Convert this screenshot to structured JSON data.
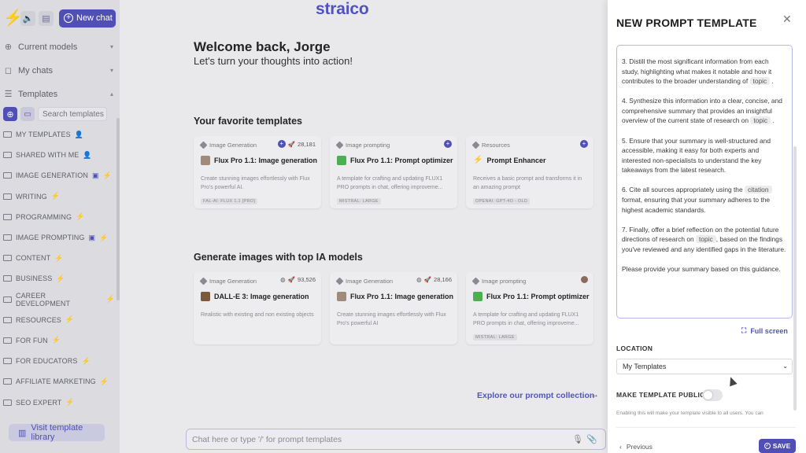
{
  "sidebar": {
    "new_chat_label": "New chat",
    "sections": [
      {
        "label": "Current models"
      },
      {
        "label": "My chats"
      },
      {
        "label": "Templates"
      }
    ],
    "search_placeholder": "Search templates",
    "folders": [
      {
        "label": "MY TEMPLATES",
        "badge": "user"
      },
      {
        "label": "SHARED WITH ME",
        "badge": "user"
      },
      {
        "label": "IMAGE GENERATION",
        "badge": "image-bolt"
      },
      {
        "label": "WRITING",
        "badge": "bolt"
      },
      {
        "label": "PROGRAMMING",
        "badge": "bolt"
      },
      {
        "label": "IMAGE PROMPTING",
        "badge": "image-bolt"
      },
      {
        "label": "CONTENT",
        "badge": "bolt"
      },
      {
        "label": "BUSINESS",
        "badge": "bolt"
      },
      {
        "label": "CAREER DEVELOPMENT",
        "badge": "bolt"
      },
      {
        "label": "RESOURCES",
        "badge": "bolt"
      },
      {
        "label": "FOR FUN",
        "badge": "bolt"
      },
      {
        "label": "FOR EDUCATORS",
        "badge": "bolt"
      },
      {
        "label": "AFFILIATE MARKETING",
        "badge": "bolt"
      },
      {
        "label": "SEO EXPERT",
        "badge": "bolt"
      }
    ],
    "visit_label": "Visit template library"
  },
  "main": {
    "brand": "straico",
    "welcome": "Welcome back, Jorge",
    "subtitle": "Let's turn your thoughts into action!",
    "favorites_title": "Your favorite templates",
    "favorites": [
      {
        "category": "Image Generation",
        "count": "28,181",
        "name": "Flux Pro 1.1: Image generation",
        "desc": "Create stunning images effortlessly with Flux Pro's powerful AI.",
        "model": "FAL-AI: FLUX 1.1 [PRO]",
        "icon_color": "#a08a7a"
      },
      {
        "category": "Image prompting",
        "count": "",
        "name": "Flux Pro 1.1: Prompt optimizer",
        "desc": "A template for crafting and updating FLUX1 PRO prompts in chat, offering improveme...",
        "model": "MISTRAL: LARGE",
        "icon_color": "#4caf50"
      },
      {
        "category": "Resources",
        "count": "",
        "name": "Prompt Enhancer",
        "desc": "Receives a basic prompt and transforms it in an amazing prompt",
        "model": "OPENAI: GPT-4O - OLD",
        "icon_color": "#ff9800"
      }
    ],
    "generate_title": "Generate images with top IA models",
    "generate": [
      {
        "category": "Image Generation",
        "count": "93,526",
        "name": "DALL-E 3: Image generation",
        "desc": "Realistic with existing and non existing objects",
        "model": "",
        "icon_color": "#7a5a3a"
      },
      {
        "category": "Image Generation",
        "count": "28,166",
        "name": "Flux Pro 1.1: Image generation",
        "desc": "Create stunning images effortlessly with Flux Pro's powerful AI",
        "model": "",
        "icon_color": "#a08a7a"
      },
      {
        "category": "Image prompting",
        "count": "",
        "name": "Flux Pro 1.1: Prompt optimizer",
        "desc": "A template for crafting and updating FLUX1 PRO prompts in chat, offering improveme...",
        "model": "MISTRAL: LARGE",
        "icon_color": "#4caf50"
      }
    ],
    "explore_label": "Explore our prompt collection",
    "chat_placeholder": "Chat here or type '/' for prompt templates"
  },
  "panel": {
    "title": "NEW PROMPT TEMPLATE",
    "prompt": {
      "p3_before": "3. Distill the most significant information from each study, highlighting what makes it notable and how it contributes to the broader understanding of",
      "p3_var": "topic",
      "p3_after": ".",
      "p4_before": "4. Synthesize this information into a clear, concise, and comprehensive summary that provides an insightful overview of the current state of research on",
      "p4_var": "topic",
      "p4_after": ".",
      "p5": "5. Ensure that your summary is well-structured and accessible, making it easy for both experts and interested non-specialists to understand the key takeaways from the latest research.",
      "p6_before": "6. Cite all sources appropriately using the",
      "p6_var": "citation",
      "p6_after": "format, ensuring that your summary adheres to the highest academic standards.",
      "p7_before": "7. Finally, offer a brief reflection on the potential future directions of research on",
      "p7_var": "topic",
      "p7_after": ", based on the findings you've reviewed and any identified gaps in the literature.",
      "p8": "Please provide your summary based on this guidance."
    },
    "fullscreen_label": "Full screen",
    "location_label": "LOCATION",
    "location_value": "My Templates",
    "public_label": "MAKE TEMPLATE PUBLIC",
    "public_help": "Enabling this will make your template visible to all users. You can",
    "previous_label": "Previous",
    "save_label": "SAVE"
  }
}
